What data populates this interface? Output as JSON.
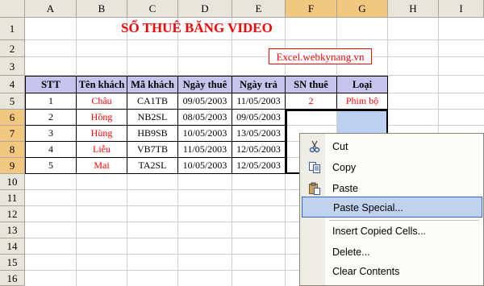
{
  "columns": [
    "A",
    "B",
    "C",
    "D",
    "E",
    "F",
    "G",
    "H",
    "I"
  ],
  "rows": [
    "1",
    "2",
    "3",
    "4",
    "5",
    "6",
    "7",
    "8",
    "9",
    "10",
    "11",
    "12",
    "13",
    "14",
    "15",
    "16"
  ],
  "title": "SỔ THUÊ BĂNG VIDEO",
  "website": "Excel.webkynang.vn",
  "table": {
    "headers": [
      "STT",
      "Tên khách",
      "Mã khách",
      "Ngày thuê",
      "Ngày trả",
      "SN thuê",
      "Loại"
    ],
    "rows": [
      {
        "stt": "1",
        "ten": "Châu",
        "ma": "CA1TB",
        "thue": "09/05/2003",
        "tra": "11/05/2003",
        "sn": "2",
        "loai": "Phim bộ"
      },
      {
        "stt": "2",
        "ten": "Hồng",
        "ma": "NB2SL",
        "thue": "08/05/2003",
        "tra": "09/05/2003",
        "sn": "",
        "loai": ""
      },
      {
        "stt": "3",
        "ten": "Hùng",
        "ma": "HB9SB",
        "thue": "10/05/2003",
        "tra": "13/05/2003",
        "sn": "",
        "loai": ""
      },
      {
        "stt": "4",
        "ten": "Liễu",
        "ma": "VB7TB",
        "thue": "11/05/2003",
        "tra": "12/05/2003",
        "sn": "",
        "loai": ""
      },
      {
        "stt": "5",
        "ten": "Mai",
        "ma": "TA2SL",
        "thue": "10/05/2003",
        "tra": "12/05/2003",
        "sn": "",
        "loai": ""
      }
    ]
  },
  "context_menu": {
    "cut": {
      "icon": "scissors-icon",
      "label": "Cut"
    },
    "copy": {
      "icon": "copy-icon",
      "label": "Copy"
    },
    "paste": {
      "icon": "paste-icon",
      "label": "Paste"
    },
    "paste_special": {
      "label": "Paste Special..."
    },
    "insert_copied": {
      "label": "Insert Copied Cells..."
    },
    "delete": {
      "label": "Delete..."
    },
    "clear": {
      "label": "Clear Contents"
    }
  },
  "colors": {
    "header_fill": "#c6c3ec",
    "accent_red": "#ff0000",
    "selection": "#bcd0f0",
    "menu_highlight": "#c1d2ee"
  }
}
